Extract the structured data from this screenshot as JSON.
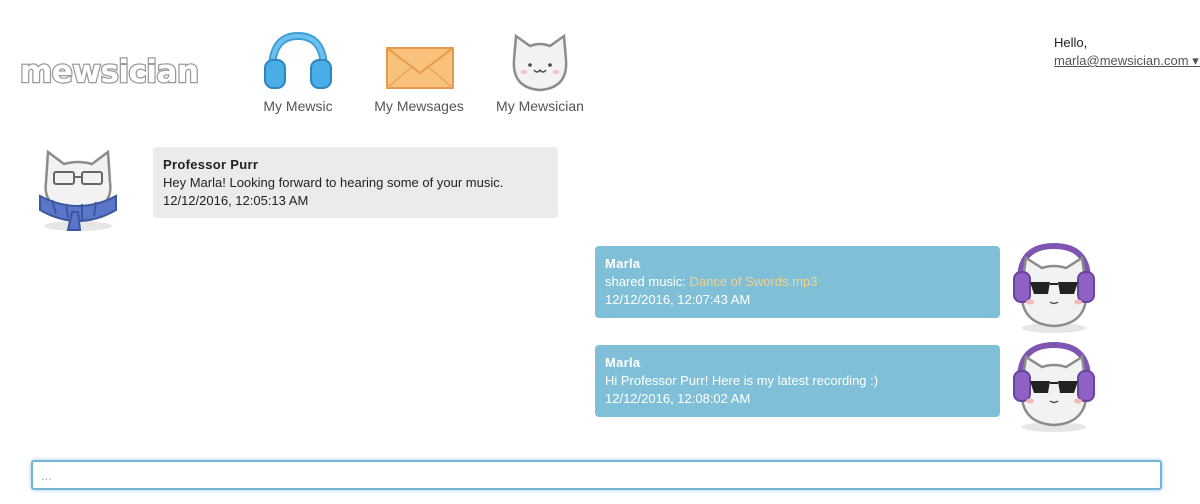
{
  "brand": {
    "logo_text": "mewsician"
  },
  "nav": {
    "items": [
      {
        "label": "My Mewsic",
        "icon": "headphones-icon"
      },
      {
        "label": "My Mewsages",
        "icon": "envelope-icon"
      },
      {
        "label": "My Mewsician",
        "icon": "cat-face-icon"
      }
    ]
  },
  "user": {
    "greeting": "Hello,",
    "email": "marla@mewsician.com",
    "menu_glyph": "▾!"
  },
  "messages": [
    {
      "side": "left",
      "sender": "Professor Purr",
      "text": "Hey Marla! Looking forward to hearing some of your music.",
      "timestamp": "12/12/2016, 12:05:13 AM"
    },
    {
      "side": "right",
      "sender": "Marla",
      "text_prefix": "shared music: ",
      "link": "Dance of Swords.mp3",
      "timestamp": "12/12/2016, 12:07:43 AM"
    },
    {
      "side": "right",
      "sender": "Marla",
      "text": "Hi Professor Purr! Here is my latest recording :)",
      "timestamp": "12/12/2016, 12:08:02 AM"
    }
  ],
  "composer": {
    "placeholder": "...",
    "value": ""
  },
  "colors": {
    "left_bubble": "#ebebeb",
    "right_bubble": "#7fc0d8",
    "link": "#f6d186",
    "composer_border": "#74b4d4"
  }
}
